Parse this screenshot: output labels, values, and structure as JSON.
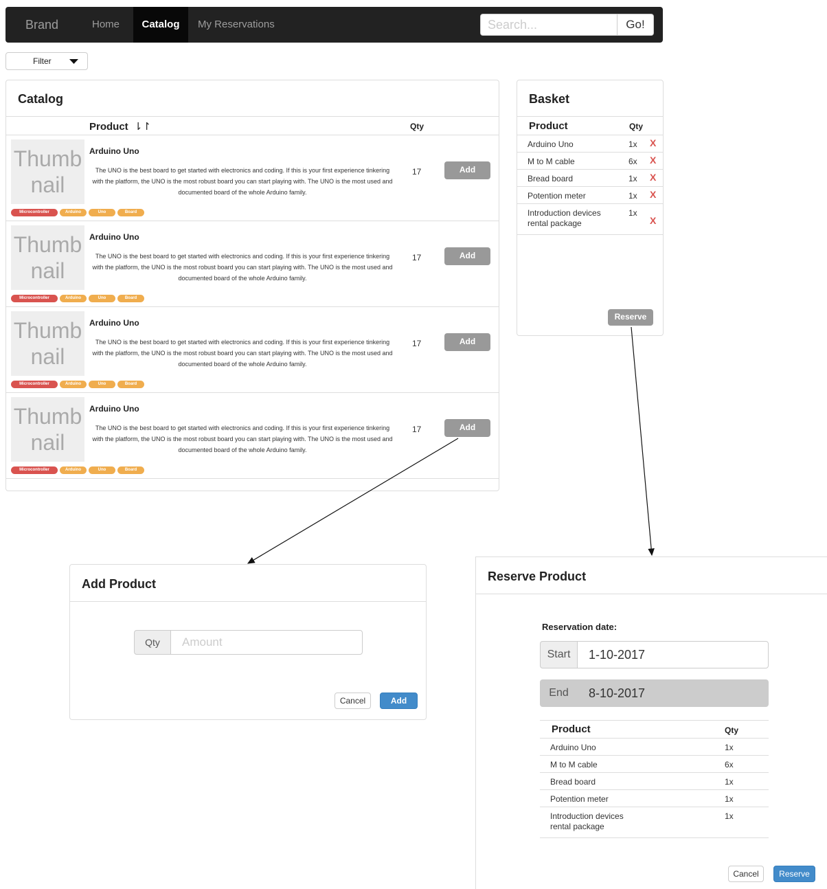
{
  "navbar": {
    "brand": "Brand",
    "home": "Home",
    "catalog": "Catalog",
    "reservations": "My Reservations",
    "search_placeholder": "Search...",
    "search_button": "Go!"
  },
  "filter": {
    "label": "Filter"
  },
  "catalog": {
    "title": "Catalog",
    "col_product": "Product",
    "col_qty": "Qty",
    "sort_icon": "⇂↾",
    "items": [
      {
        "thumb": "Thumb nail",
        "name": "Arduino Uno",
        "desc": "The UNO is the best board to get started with electronics and coding. If this is your first experience tinkering with the platform, the UNO is the most robust board you can start playing with. The UNO is the most used and documented board of the whole Arduino family.",
        "qty": "17",
        "add": "Add",
        "tags": [
          "Microcontroller",
          "Arduino",
          "Uno",
          "Board"
        ]
      },
      {
        "thumb": "Thumb nail",
        "name": "Arduino Uno",
        "desc": "The UNO is the best board to get started with electronics and coding. If this is your first experience tinkering with the platform, the UNO is the most robust board you can start playing with. The UNO is the most used and documented board of the whole Arduino family.",
        "qty": "17",
        "add": "Add",
        "tags": [
          "Microcontroller",
          "Arduino",
          "Uno",
          "Board"
        ]
      },
      {
        "thumb": "Thumb nail",
        "name": "Arduino Uno",
        "desc": "The UNO is the best board to get started with electronics and coding. If this is your first experience tinkering with the platform, the UNO is the most robust board you can start playing with. The UNO is the most used and documented board of the whole Arduino family.",
        "qty": "17",
        "add": "Add",
        "tags": [
          "Microcontroller",
          "Arduino",
          "Uno",
          "Board"
        ]
      },
      {
        "thumb": "Thumb nail",
        "name": "Arduino Uno",
        "desc": "The UNO is the best board to get started with electronics and coding. If this is your first experience tinkering with the platform, the UNO is the most robust board you can start playing with. The UNO is the most used and documented board of the whole Arduino family.",
        "qty": "17",
        "add": "Add",
        "tags": [
          "Microcontroller",
          "Arduino",
          "Uno",
          "Board"
        ]
      }
    ]
  },
  "basket": {
    "title": "Basket",
    "col_product": "Product",
    "col_qty": "Qty",
    "items": [
      {
        "product": "Arduino Uno",
        "qty": "1x",
        "remove": "X"
      },
      {
        "product": "M to M cable",
        "qty": "6x",
        "remove": "X"
      },
      {
        "product": "Bread board",
        "qty": "1x",
        "remove": "X"
      },
      {
        "product": "Potention meter",
        "qty": "1x",
        "remove": "X"
      },
      {
        "product": "Introduction devices rental package",
        "qty": "1x",
        "remove": "X"
      }
    ],
    "reserve": "Reserve"
  },
  "add_modal": {
    "title": "Add Product",
    "qty_label": "Qty",
    "amount_placeholder": "Amount",
    "cancel": "Cancel",
    "add": "Add"
  },
  "reserve_modal": {
    "title": "Reserve Product",
    "date_label": "Reservation date:",
    "start_label": "Start",
    "start_value": "1-10-2017",
    "end_label": "End",
    "end_value": "8-10-2017",
    "col_product": "Product",
    "col_qty": "Qty",
    "items": [
      {
        "product": "Arduino Uno",
        "qty": "1x"
      },
      {
        "product": "M to M cable",
        "qty": "6x"
      },
      {
        "product": "Bread board",
        "qty": "1x"
      },
      {
        "product": "Potention meter",
        "qty": "1x"
      },
      {
        "product": "Introduction devices rental package",
        "qty": "1x"
      }
    ],
    "cancel": "Cancel",
    "reserve": "Reserve"
  },
  "colors": {
    "navbar": "#222222",
    "danger": "#d9534f",
    "warning": "#f0ad4e",
    "primary": "#428bca"
  }
}
